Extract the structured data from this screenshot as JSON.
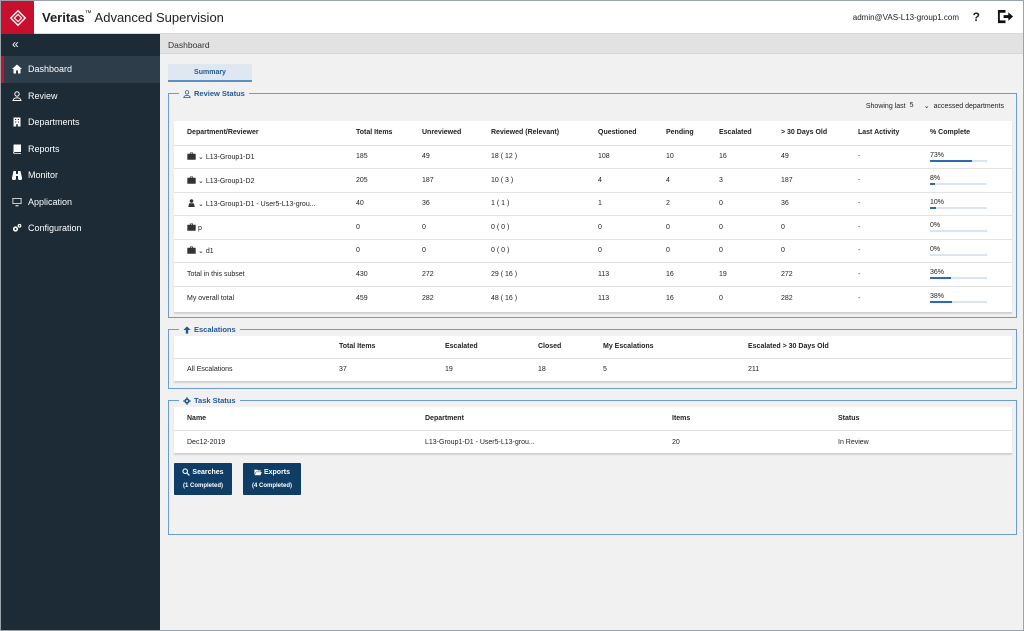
{
  "header": {
    "brand_bold": "Veritas",
    "brand_tm": "™",
    "brand_rest": " Advanced Supervision",
    "user": "admin@VAS-L13-group1.com",
    "help": "?"
  },
  "sidebar": {
    "collapse": "«",
    "items": [
      {
        "label": "Dashboard",
        "icon": "home-icon"
      },
      {
        "label": "Review",
        "icon": "user-icon"
      },
      {
        "label": "Departments",
        "icon": "building-icon"
      },
      {
        "label": "Reports",
        "icon": "book-icon"
      },
      {
        "label": "Monitor",
        "icon": "binoculars-icon"
      },
      {
        "label": "Application",
        "icon": "monitor-icon"
      },
      {
        "label": "Configuration",
        "icon": "gears-icon"
      }
    ]
  },
  "breadcrumb": "Dashboard",
  "tab": "Summary",
  "review_status": {
    "title": "Review Status",
    "showing_prefix": "Showing last",
    "showing_value": "5",
    "showing_suffix": "accessed departments",
    "columns": [
      "Department/Reviewer",
      "Total Items",
      "Unreviewed",
      "Reviewed (Relevant)",
      "Questioned",
      "Pending",
      "Escalated",
      "> 30 Days Old",
      "Last Activity",
      "% Complete"
    ],
    "rows": [
      {
        "name": "L13-Group1-D1",
        "icon": "briefcase-icon",
        "chevron": "⌄",
        "total": "185",
        "unreviewed": "49",
        "reviewed": "18 ( 12 )",
        "questioned": "108",
        "pending": "10",
        "escalated": "16",
        "old": "49",
        "last": "-",
        "pct": "73%",
        "pct_value": 73
      },
      {
        "name": "L13-Group1-D2",
        "icon": "briefcase-icon",
        "chevron": "⌄",
        "total": "205",
        "unreviewed": "187",
        "reviewed": "10 ( 3 )",
        "questioned": "4",
        "pending": "4",
        "escalated": "3",
        "old": "187",
        "last": "-",
        "pct": "8%",
        "pct_value": 8
      },
      {
        "name": "L13-Group1-D1 - User5-L13-grou...",
        "icon": "person-icon",
        "chevron": "⌄",
        "total": "40",
        "unreviewed": "36",
        "reviewed": "1 ( 1 )",
        "questioned": "1",
        "pending": "2",
        "escalated": "0",
        "old": "36",
        "last": "-",
        "pct": "10%",
        "pct_value": 10
      },
      {
        "name": "p",
        "icon": "briefcase-icon",
        "chevron": "",
        "total": "0",
        "unreviewed": "0",
        "reviewed": "0 ( 0 )",
        "questioned": "0",
        "pending": "0",
        "escalated": "0",
        "old": "0",
        "last": "-",
        "pct": "0%",
        "pct_value": 0
      },
      {
        "name": "d1",
        "icon": "briefcase-icon",
        "chevron": "⌄",
        "total": "0",
        "unreviewed": "0",
        "reviewed": "0 ( 0 )",
        "questioned": "0",
        "pending": "0",
        "escalated": "0",
        "old": "0",
        "last": "-",
        "pct": "0%",
        "pct_value": 0
      },
      {
        "name": "Total in this subset",
        "icon": "",
        "chevron": "",
        "total": "430",
        "unreviewed": "272",
        "reviewed": "29 ( 16 )",
        "questioned": "113",
        "pending": "16",
        "escalated": "19",
        "old": "272",
        "last": "-",
        "pct": "36%",
        "pct_value": 36
      },
      {
        "name": "My overall total",
        "icon": "",
        "chevron": "",
        "total": "459",
        "unreviewed": "282",
        "reviewed": "48 ( 16 )",
        "questioned": "113",
        "pending": "16",
        "escalated": "0",
        "old": "282",
        "last": "-",
        "pct": "38%",
        "pct_value": 38
      }
    ]
  },
  "escalations": {
    "title": "Escalations",
    "columns": [
      "",
      "Total Items",
      "Escalated",
      "Closed",
      "My Escalations",
      "Escalated > 30 Days Old"
    ],
    "row": [
      "All Escalations",
      "37",
      "19",
      "18",
      "5",
      "211"
    ]
  },
  "task_status": {
    "title": "Task Status",
    "columns": [
      "Name",
      "Department",
      "Items",
      "Status"
    ],
    "row": [
      "Dec12-2019",
      "L13-Group1-D1 - User5-L13-grou...",
      "20",
      "In Review"
    ]
  },
  "buttons": {
    "searches_label": "Searches",
    "searches_sub": "(1 Completed)",
    "exports_label": "Exports",
    "exports_sub": "(4 Completed)"
  },
  "colors": {
    "brand": "#c8102e",
    "sidebar": "#1c2b36",
    "accent": "#1f5a93",
    "button": "#0f3d66"
  }
}
